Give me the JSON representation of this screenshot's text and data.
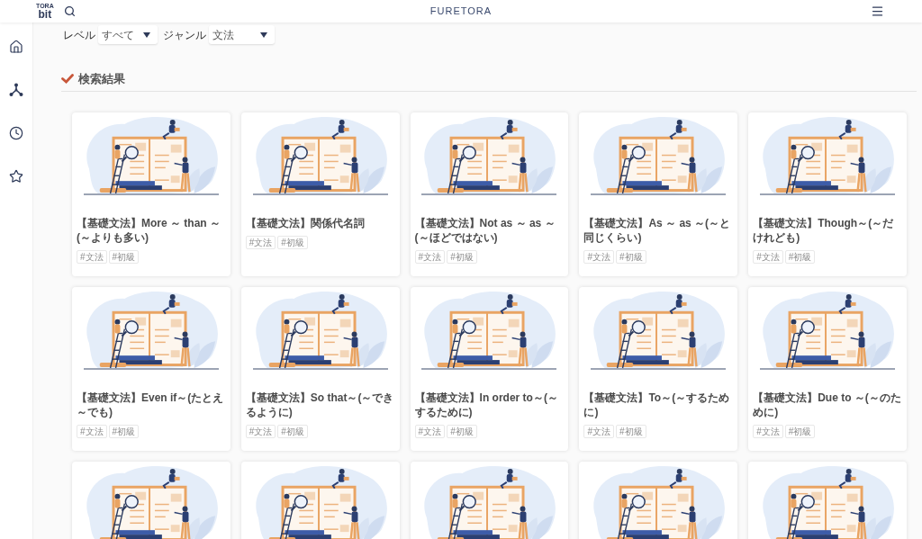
{
  "header": {
    "logo": {
      "top": "TORA",
      "bottom": "bit"
    },
    "title": "FURETORA"
  },
  "filters": [
    {
      "label": "レベル",
      "value": "すべて"
    },
    {
      "label": "ジャンル",
      "value": "文法"
    }
  ],
  "results": {
    "heading": "検索結果",
    "cards": [
      {
        "kind": "article",
        "title": "【基礎文法】More ～ than ～(～よりも多い)",
        "tags": [
          "#文法",
          "#初級"
        ]
      },
      {
        "kind": "article",
        "title": "【基礎文法】関係代名詞",
        "tags": [
          "#文法",
          "#初級"
        ]
      },
      {
        "kind": "article",
        "title": "【基礎文法】Not as ～ as ～(～ほどではない)",
        "tags": [
          "#文法",
          "#初級"
        ]
      },
      {
        "kind": "article",
        "title": "【基礎文法】As ～ as ～(～と同じくらい)",
        "tags": [
          "#文法",
          "#初級"
        ]
      },
      {
        "kind": "article",
        "title": "【基礎文法】Though～(～だけれども)",
        "tags": [
          "#文法",
          "#初級"
        ]
      },
      {
        "kind": "article",
        "title": "【基礎文法】Even if～(たとえ～でも)",
        "tags": [
          "#文法",
          "#初級"
        ]
      },
      {
        "kind": "article",
        "title": "【基礎文法】So that～(～できるように)",
        "tags": [
          "#文法",
          "#初級"
        ]
      },
      {
        "kind": "article",
        "title": "【基礎文法】In order to～(～するために)",
        "tags": [
          "#文法",
          "#初級"
        ]
      },
      {
        "kind": "article",
        "title": "【基礎文法】To～(～するために)",
        "tags": [
          "#文法",
          "#初級"
        ]
      },
      {
        "kind": "article",
        "title": "【基礎文法】Due to ～(～のために)",
        "tags": [
          "#文法",
          "#初級"
        ]
      },
      {
        "kind": "image"
      },
      {
        "kind": "image"
      },
      {
        "kind": "image"
      },
      {
        "kind": "image"
      },
      {
        "kind": "image"
      }
    ]
  }
}
